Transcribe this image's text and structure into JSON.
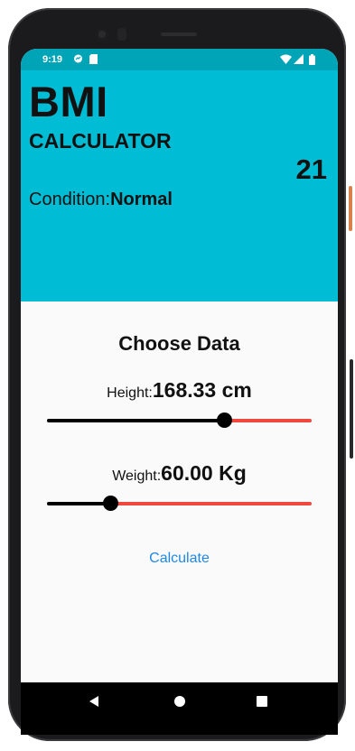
{
  "status_bar": {
    "time": "9:19",
    "icons": [
      "messenger-icon",
      "sd-card-icon",
      "wifi-icon",
      "signal-icon",
      "battery-icon"
    ]
  },
  "header": {
    "title": "BMI",
    "subtitle": "CALCULATOR",
    "bmi_value": "21",
    "condition_label": "Condition:",
    "condition_value": "Normal"
  },
  "content": {
    "heading": "Choose Data",
    "height": {
      "label": "Height:",
      "value": "168.33 cm",
      "slider_fraction": 0.67
    },
    "weight": {
      "label": "Weight:",
      "value": "60.00 Kg",
      "slider_fraction": 0.24
    },
    "calculate_label": "Calculate"
  },
  "nav_bar": {
    "icons": [
      "back-icon",
      "home-icon",
      "recents-icon"
    ]
  },
  "colors": {
    "header_bg": "#00bcd4",
    "status_bg": "#00a4b7",
    "slider_active": "#000000",
    "slider_inactive": "#f0473f",
    "button_text": "#1e88e5"
  }
}
